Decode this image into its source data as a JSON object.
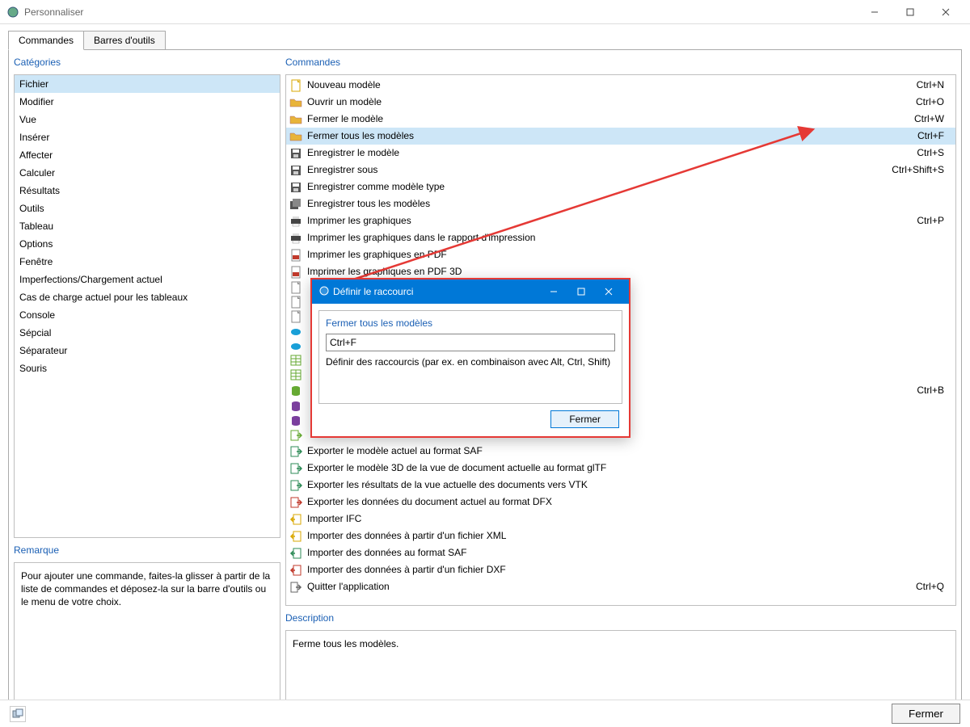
{
  "window": {
    "title": "Personnaliser"
  },
  "tabs": {
    "commands": "Commandes",
    "toolbars": "Barres d'outils"
  },
  "categories": {
    "title": "Catégories",
    "items": [
      "Fichier",
      "Modifier",
      "Vue",
      "Insérer",
      "Affecter",
      "Calculer",
      "Résultats",
      "Outils",
      "Tableau",
      "Options",
      "Fenêtre",
      "Imperfections/Chargement actuel",
      "Cas de charge actuel pour les tableaux",
      "Console",
      "Sépcial",
      "Séparateur",
      "Souris"
    ],
    "selected_index": 0
  },
  "commands": {
    "title": "Commandes",
    "selected_index": 3,
    "items": [
      {
        "label": "Nouveau modèle",
        "shortcut": "Ctrl+N",
        "icon": "doc",
        "c": "#d9a700"
      },
      {
        "label": "Ouvrir un modèle",
        "shortcut": "Ctrl+O",
        "icon": "folder",
        "c": "#e8b43a"
      },
      {
        "label": "Fermer le modèle",
        "shortcut": "Ctrl+W",
        "icon": "folder",
        "c": "#e8b43a"
      },
      {
        "label": "Fermer tous les modèles",
        "shortcut": "Ctrl+F",
        "icon": "folder",
        "c": "#e8b43a"
      },
      {
        "label": "Enregistrer le modèle",
        "shortcut": "Ctrl+S",
        "icon": "disk",
        "c": "#555"
      },
      {
        "label": "Enregistrer sous",
        "shortcut": "Ctrl+Shift+S",
        "icon": "disk",
        "c": "#555"
      },
      {
        "label": "Enregistrer comme modèle type",
        "shortcut": "",
        "icon": "disk",
        "c": "#555"
      },
      {
        "label": "Enregistrer tous les modèles",
        "shortcut": "",
        "icon": "disks",
        "c": "#555"
      },
      {
        "label": "Imprimer les graphiques",
        "shortcut": "Ctrl+P",
        "icon": "printer",
        "c": "#444"
      },
      {
        "label": "Imprimer les graphiques dans le rapport d'impression",
        "shortcut": "",
        "icon": "printer",
        "c": "#444"
      },
      {
        "label": "Imprimer les graphiques en PDF",
        "shortcut": "",
        "icon": "pdf",
        "c": "#c0392b"
      },
      {
        "label": "Imprimer les graphiques en PDF 3D",
        "shortcut": "",
        "icon": "pdf",
        "c": "#c0392b"
      },
      {
        "label": "",
        "shortcut": "",
        "icon": "doc",
        "c": "#888"
      },
      {
        "label": "",
        "shortcut": "",
        "icon": "doc",
        "c": "#888"
      },
      {
        "label": "",
        "shortcut": "",
        "icon": "doc",
        "c": "#888"
      },
      {
        "label": "",
        "shortcut": "",
        "icon": "cloud",
        "c": "#1aa0d8"
      },
      {
        "label": "",
        "shortcut": "",
        "icon": "cloud",
        "c": "#1aa0d8"
      },
      {
        "label": "",
        "shortcut": "",
        "icon": "table",
        "c": "#6a3"
      },
      {
        "label": "",
        "shortcut": "",
        "icon": "table",
        "c": "#6a3"
      },
      {
        "label": "",
        "shortcut": "Ctrl+B",
        "icon": "db",
        "c": "#6a3"
      },
      {
        "label": "",
        "shortcut": "",
        "icon": "db",
        "c": "#7b3f9e"
      },
      {
        "label": "",
        "shortcut": "",
        "icon": "db",
        "c": "#7b3f9e"
      },
      {
        "label": "",
        "shortcut": "",
        "icon": "export",
        "c": "#6a3"
      },
      {
        "label": "Exporter le modèle actuel au format SAF",
        "shortcut": "",
        "icon": "export",
        "c": "#2e8b57"
      },
      {
        "label": "Exporter le modèle 3D de la vue de document actuelle au format glTF",
        "shortcut": "",
        "icon": "export",
        "c": "#2e8b57"
      },
      {
        "label": "Exporter les résultats de la vue actuelle des documents vers VTK",
        "shortcut": "",
        "icon": "export",
        "c": "#2e8b57"
      },
      {
        "label": "Exporter les données du document actuel au format DFX",
        "shortcut": "",
        "icon": "export",
        "c": "#c0392b"
      },
      {
        "label": "Importer IFC",
        "shortcut": "",
        "icon": "import",
        "c": "#d9a700"
      },
      {
        "label": "Importer des données à partir d'un fichier XML",
        "shortcut": "",
        "icon": "import",
        "c": "#d9a700"
      },
      {
        "label": "Importer des données au format SAF",
        "shortcut": "",
        "icon": "import",
        "c": "#2e8b57"
      },
      {
        "label": "Importer des données à partir d'un fichier DXF",
        "shortcut": "",
        "icon": "import",
        "c": "#c0392b"
      },
      {
        "label": "Quitter l'application",
        "shortcut": "Ctrl+Q",
        "icon": "exit",
        "c": "#666"
      }
    ]
  },
  "remark": {
    "title": "Remarque",
    "text": "Pour ajouter une commande, faites-la glisser à partir de la liste de commandes et déposez-la sur la barre d'outils ou le menu de votre choix."
  },
  "description": {
    "title": "Description",
    "text": "Ferme tous les modèles."
  },
  "footer": {
    "close": "Fermer"
  },
  "modal": {
    "title": "Définir le raccourci",
    "header": "Fermer tous les modèles",
    "value": "Ctrl+F",
    "hint": "Définir des raccourcis (par ex. en combinaison avec Alt, Ctrl, Shift)",
    "close": "Fermer"
  }
}
